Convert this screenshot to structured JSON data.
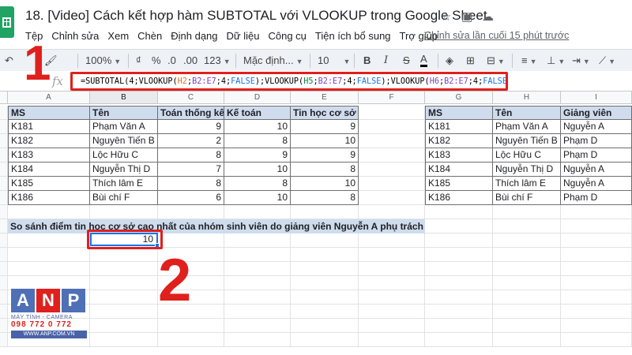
{
  "title_bar": {
    "title": "18. [Video] Cách kết hợp hàm SUBTOTAL với VLOOKUP trong Google Sheet",
    "icons": [
      "star-icon",
      "move-to-folder-icon",
      "cloud-status-icon"
    ]
  },
  "menu": {
    "items": [
      "Tệp",
      "Chỉnh sửa",
      "Xem",
      "Chèn",
      "Định dạng",
      "Dữ liệu",
      "Công cụ",
      "Tiện ích bổ sung",
      "Trợ giúp"
    ],
    "last_edit": "Chỉnh sửa lần cuối 15 phút trước"
  },
  "toolbar": {
    "zoom": "100%",
    "currency": "₫",
    "percent": "%",
    "decimal_decrease": ".0",
    "decimal_increase": ".00",
    "more_formats": "123",
    "font": "Mặc định...",
    "font_size": "10",
    "bold": "B",
    "italic": "I",
    "strike": "S",
    "text_color": "A"
  },
  "formula_bar": {
    "fx": "fx",
    "formula_parts": [
      {
        "text": "=SUBTOTAL(4;VLOOKUP(",
        "cls": ""
      },
      {
        "text": "H2",
        "cls": "ref-a"
      },
      {
        "text": ";",
        "cls": ""
      },
      {
        "text": "B2:E7",
        "cls": "ref-b"
      },
      {
        "text": ";4;",
        "cls": ""
      },
      {
        "text": "FALSE",
        "cls": "kw"
      },
      {
        "text": ");VLOOKUP(",
        "cls": ""
      },
      {
        "text": "H5",
        "cls": "ref-c"
      },
      {
        "text": ";",
        "cls": ""
      },
      {
        "text": "B2:E7",
        "cls": "ref-b"
      },
      {
        "text": ";4;",
        "cls": ""
      },
      {
        "text": "FALSE",
        "cls": "kw"
      },
      {
        "text": ");VLOOKUP(",
        "cls": ""
      },
      {
        "text": "H6",
        "cls": "ref-b"
      },
      {
        "text": ";",
        "cls": ""
      },
      {
        "text": "B2:E7",
        "cls": "ref-b"
      },
      {
        "text": ";4;",
        "cls": ""
      },
      {
        "text": "FALSE",
        "cls": "kw"
      },
      {
        "text": "))",
        "cls": ""
      }
    ]
  },
  "annotations": {
    "step1": "1",
    "step2": "2"
  },
  "columns": [
    "A",
    "B",
    "C",
    "D",
    "E",
    "F",
    "G",
    "H",
    "I"
  ],
  "main_table": {
    "headers": [
      "MS",
      "Tên",
      "Toán thống kê",
      "Kế toán",
      "Tin học cơ sở"
    ],
    "rows": [
      [
        "K181",
        "Phạm Văn A",
        "9",
        "10",
        "9"
      ],
      [
        "K182",
        "Nguyên Tiến B",
        "2",
        "8",
        "10"
      ],
      [
        "K183",
        "Lộc Hữu C",
        "8",
        "9",
        "9"
      ],
      [
        "K184",
        "Nguyễn Thị D",
        "7",
        "10",
        "8"
      ],
      [
        "K185",
        "Thích lâm E",
        "8",
        "8",
        "10"
      ],
      [
        "K186",
        "Bùi chí F",
        "6",
        "10",
        "8"
      ]
    ]
  },
  "side_table": {
    "headers": [
      "MS",
      "Tên",
      "Giảng viên"
    ],
    "rows": [
      [
        "K181",
        "Phạm Văn A",
        "Nguyễn A"
      ],
      [
        "K182",
        "Nguyên Tiến B",
        "Phạm D"
      ],
      [
        "K183",
        "Lộc Hữu C",
        "Phạm D"
      ],
      [
        "K184",
        "Nguyễn Thị D",
        "Nguyễn A"
      ],
      [
        "K185",
        "Thích lâm E",
        "Nguyễn A"
      ],
      [
        "K186",
        "Bùi chí F",
        "Phạm D"
      ]
    ]
  },
  "note": "So sánh điểm tin học cơ sở cao nhất của nhóm sinh viên do giảng viên Nguyễn A phụ trách",
  "result_value": "10",
  "logo": {
    "letters": [
      "A",
      "N",
      "P"
    ],
    "tile_colors": [
      "#4f6fb6",
      "#e0201c",
      "#4f6fb6"
    ],
    "tagline": "MÁY TÍNH - CAMERA",
    "phone": "098 772 0 772",
    "website": "WWW.ANP.COM.VN"
  },
  "colors": {
    "accent_red": "#e0201c",
    "header_fill": "#cfdcee",
    "selection_blue": "#1a73e8",
    "sheets_green": "#1fa463"
  }
}
